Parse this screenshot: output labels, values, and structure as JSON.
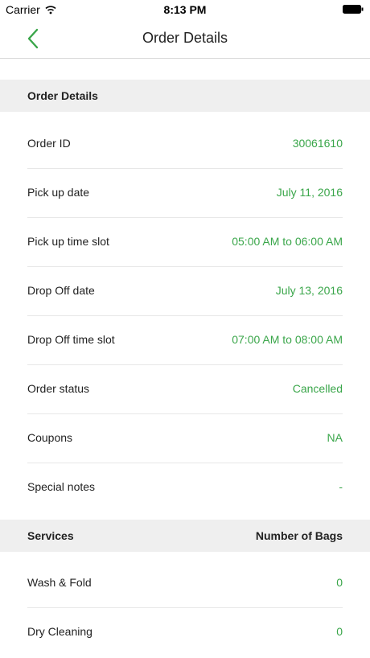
{
  "status_bar": {
    "carrier": "Carrier",
    "time": "8:13 PM"
  },
  "nav": {
    "title": "Order Details"
  },
  "order_section": {
    "header": "Order Details",
    "rows": [
      {
        "label": "Order ID",
        "value": "30061610"
      },
      {
        "label": "Pick up date",
        "value": "July 11, 2016"
      },
      {
        "label": "Pick up time slot",
        "value": "05:00 AM to 06:00 AM"
      },
      {
        "label": "Drop Off date",
        "value": "July 13, 2016"
      },
      {
        "label": "Drop Off time slot",
        "value": "07:00 AM to 08:00 AM"
      },
      {
        "label": "Order status",
        "value": "Cancelled"
      },
      {
        "label": "Coupons",
        "value": "NA"
      },
      {
        "label": "Special notes",
        "value": "-"
      }
    ]
  },
  "services_section": {
    "header_left": "Services",
    "header_right": "Number of Bags",
    "rows": [
      {
        "label": "Wash & Fold",
        "value": "0"
      },
      {
        "label": "Dry Cleaning",
        "value": "0"
      }
    ]
  },
  "colors": {
    "accent": "#3aa64a",
    "section_bg": "#efefef"
  }
}
